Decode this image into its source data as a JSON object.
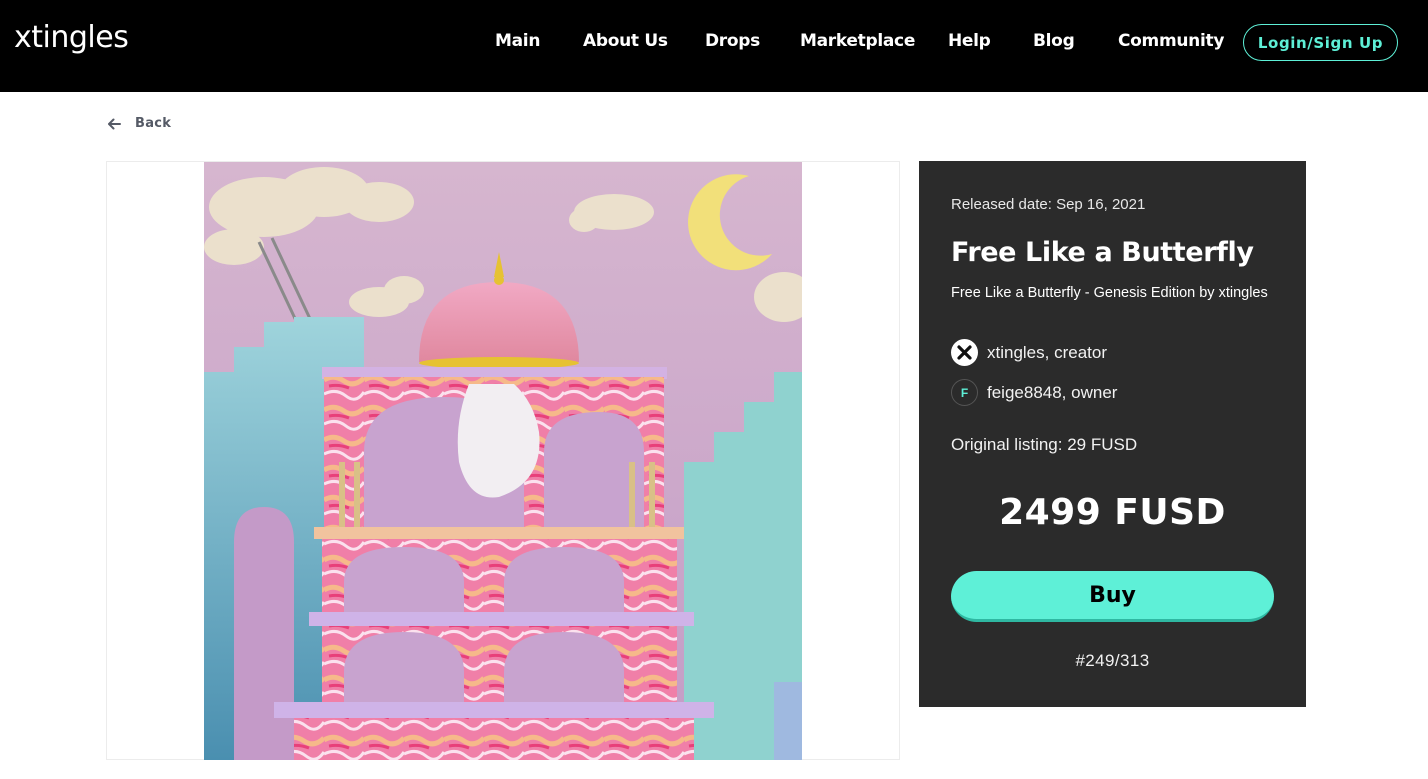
{
  "header": {
    "logo": "xtingles",
    "nav": [
      {
        "label": "Main"
      },
      {
        "label": "About Us"
      },
      {
        "label": "Drops"
      },
      {
        "label": "Marketplace"
      },
      {
        "label": "Help"
      },
      {
        "label": "Blog"
      },
      {
        "label": "Community"
      }
    ],
    "login_label": "Login/Sign Up"
  },
  "back": {
    "label": "Back",
    "icon": "arrow-left-icon"
  },
  "artwork": {
    "icon": "nft-artwork-image"
  },
  "details": {
    "released": "Released date: Sep 16, 2021",
    "title": "Free Like a Butterfly",
    "subtitle": "Free Like a Butterfly - Genesis Edition by xtingles",
    "creator": {
      "avatar_glyph": "X",
      "text": "xtingles, creator"
    },
    "owner": {
      "avatar_glyph": "F",
      "text": "feige8848, owner"
    },
    "original_listing": "Original listing: 29 FUSD",
    "price": "2499 FUSD",
    "buy_label": "Buy",
    "edition": "#249/313"
  },
  "colors": {
    "accent": "#5ef0d7",
    "header_bg": "#000000",
    "card_bg": "#2b2b2b"
  }
}
